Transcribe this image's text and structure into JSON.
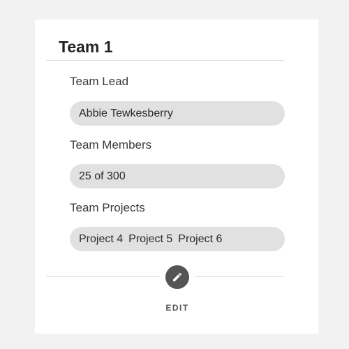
{
  "card": {
    "title": "Team 1",
    "fields": {
      "team_lead": {
        "label": "Team Lead",
        "value": "Abbie Tewkesberry"
      },
      "team_members": {
        "label": "Team Members",
        "value": "25 of 300"
      },
      "team_projects": {
        "label": "Team Projects",
        "values": [
          "Project 4",
          "Project 5",
          "Project 6"
        ]
      }
    },
    "edit": {
      "label": "EDIT",
      "icon": "pencil-icon"
    }
  },
  "colors": {
    "background": "#f2f2f2",
    "card": "#ffffff",
    "pill": "#e1e1e1",
    "button": "#555555"
  }
}
